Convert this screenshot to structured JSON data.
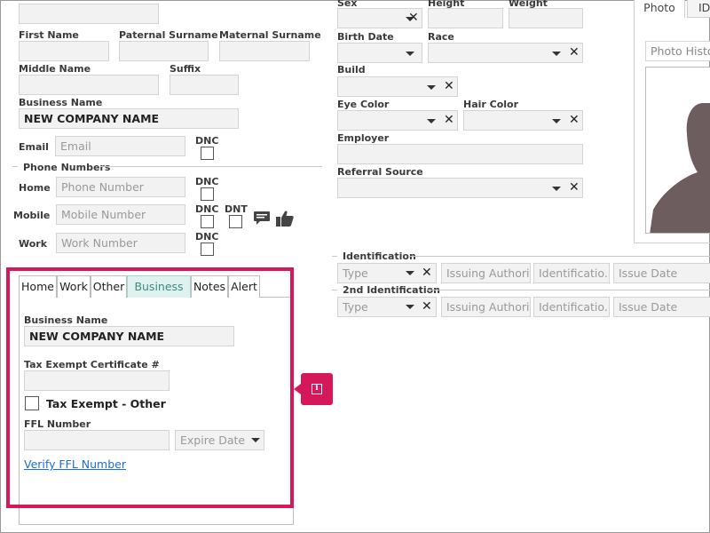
{
  "person": {
    "first_name_label": "First Name",
    "paternal_surname_label": "Paternal Surname",
    "maternal_surname_label": "Maternal Surname",
    "middle_name_label": "Middle Name",
    "suffix_label": "Suffix",
    "business_name_label": "Business Name",
    "business_name_value": "NEW COMPANY NAME",
    "email_label": "Email",
    "email_placeholder": "Email",
    "dnc_label": "DNC",
    "dnt_label": "DNT"
  },
  "phones": {
    "section_label": "Phone Numbers",
    "home_label": "Home",
    "home_placeholder": "Phone Number",
    "mobile_label": "Mobile",
    "mobile_placeholder": "Mobile Number",
    "work_label": "Work",
    "work_placeholder": "Work Number"
  },
  "physical": {
    "sex_label": "Sex",
    "height_label": "Height",
    "weight_label": "Weight",
    "birth_date_label": "Birth Date",
    "race_label": "Race",
    "build_label": "Build",
    "eye_color_label": "Eye Color",
    "hair_color_label": "Hair Color",
    "employer_label": "Employer",
    "referral_source_label": "Referral Source"
  },
  "photo": {
    "tab_photo": "Photo",
    "tab_id": "ID",
    "history_placeholder": "Photo Histor"
  },
  "identification": {
    "section_label": "Identification",
    "section2_label": "2nd Identification",
    "type_placeholder": "Type",
    "authority_placeholder": "Issuing Authority",
    "number_placeholder": "Identificatio...",
    "issue_date_placeholder": "Issue Date"
  },
  "tabs": [
    {
      "label": "Home"
    },
    {
      "label": "Work"
    },
    {
      "label": "Other"
    },
    {
      "label": "Business"
    },
    {
      "label": "Notes"
    },
    {
      "label": "Alert"
    }
  ],
  "business_tab": {
    "business_name_label": "Business Name",
    "business_name_value": "NEW COMPANY NAME",
    "tax_cert_label": "Tax Exempt Certificate #",
    "tax_exempt_other_label": "Tax Exempt - Other",
    "ffl_number_label": "FFL Number",
    "expire_date_placeholder": "Expire Date",
    "verify_link": "Verify FFL Number"
  },
  "colors": {
    "highlight": "#d6175a",
    "active_tab_bg": "#dff2ef",
    "link": "#1a6fd0"
  },
  "icons": [
    "chat-bubble-icon",
    "thumbs-up-icon",
    "info-icon",
    "silhouette-photo"
  ]
}
